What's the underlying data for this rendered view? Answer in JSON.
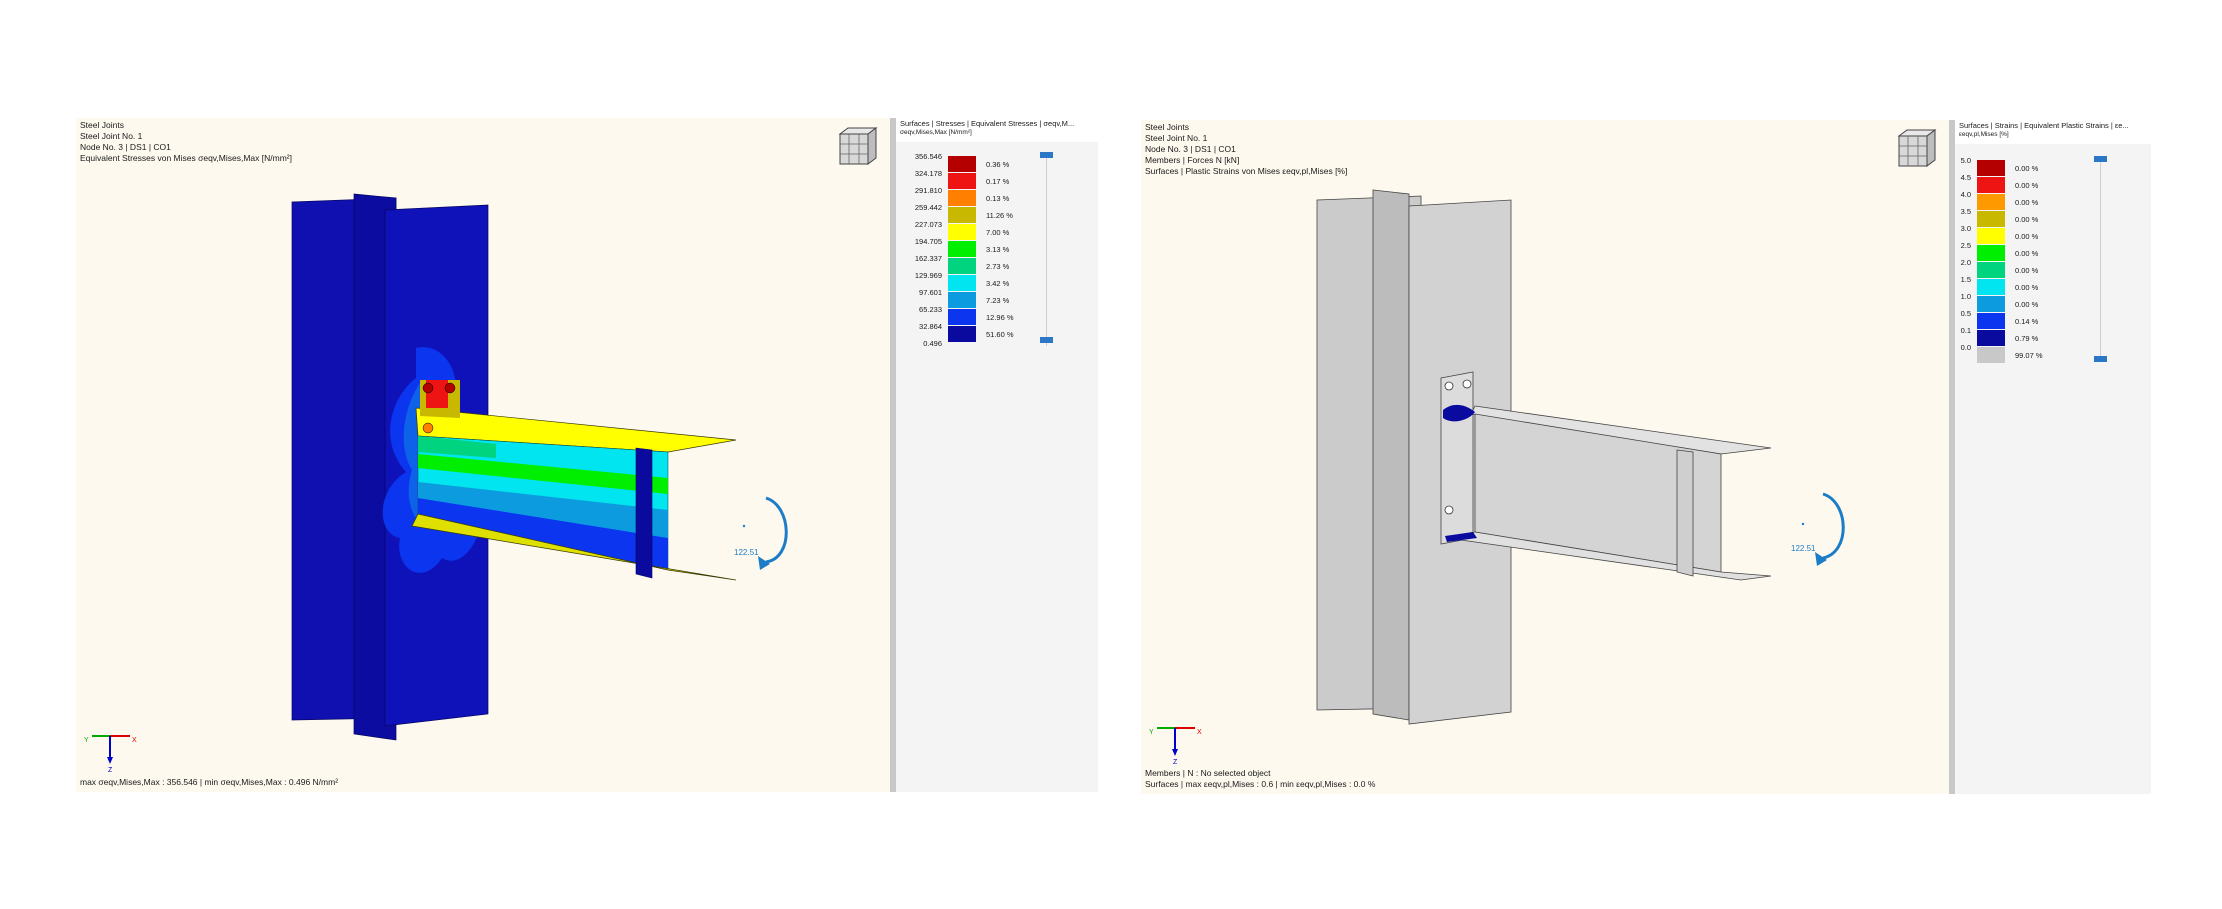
{
  "left_view": {
    "info_lines": [
      "Steel Joints",
      "Steel Joint No. 1",
      "Node No. 3 | DS1 | CO1",
      "Equivalent Stresses von Mises σeqv,Mises,Max [N/mm²]"
    ],
    "footer": "max σeqv,Mises,Max : 356.546 | min σeqv,Mises,Max : 0.496 N/mm²",
    "moment_label": "122.51"
  },
  "left_panel": {
    "title": "Surfaces | Stresses | Equivalent Stresses | σeqv,M...",
    "subtitle": "σeqv,Mises,Max [N/mm²]",
    "legend": [
      {
        "value": "356.546",
        "color": "#b40000",
        "pct": "0.36 %"
      },
      {
        "value": "324.178",
        "color": "#ee1414",
        "pct": "0.17 %"
      },
      {
        "value": "291.810",
        "color": "#ff7f00",
        "pct": "0.13 %"
      },
      {
        "value": "259.442",
        "color": "#c9b800",
        "pct": "11.26 %"
      },
      {
        "value": "227.073",
        "color": "#ffff00",
        "pct": "7.00 %"
      },
      {
        "value": "194.705",
        "color": "#00ee00",
        "pct": "3.13 %"
      },
      {
        "value": "162.337",
        "color": "#00d47f",
        "pct": "2.73 %"
      },
      {
        "value": "129.969",
        "color": "#00e5ef",
        "pct": "3.42 %"
      },
      {
        "value": "97.601",
        "color": "#0d9be0",
        "pct": "7.23 %"
      },
      {
        "value": "65.233",
        "color": "#0b35ee",
        "pct": "12.96 %"
      },
      {
        "value": "32.864",
        "color": "#0a0a9e",
        "pct": "51.60 %"
      }
    ],
    "legend_min": "0.496"
  },
  "right_view": {
    "info_lines": [
      "Steel Joints",
      "Steel Joint No. 1",
      "Node No. 3 | DS1 | CO1",
      "Members | Forces N [kN]",
      "Surfaces | Plastic Strains von Mises εeqv,pl,Mises [%]"
    ],
    "footer_lines": [
      "Members | N : No selected object",
      "Surfaces | max εeqv,pl,Mises : 0.6 | min εeqv,pl,Mises : 0.0 %"
    ],
    "moment_label": "122.51"
  },
  "right_panel": {
    "title": "Surfaces | Strains | Equivalent Plastic Strains | εe...",
    "subtitle": "εeqv,pl,Mises [%]",
    "legend": [
      {
        "value": "5.0",
        "color": "#b40000",
        "pct": "0.00 %"
      },
      {
        "value": "4.5",
        "color": "#ee1414",
        "pct": "0.00 %"
      },
      {
        "value": "4.0",
        "color": "#ff9900",
        "pct": "0.00 %"
      },
      {
        "value": "3.5",
        "color": "#c9b800",
        "pct": "0.00 %"
      },
      {
        "value": "3.0",
        "color": "#ffff00",
        "pct": "0.00 %"
      },
      {
        "value": "2.5",
        "color": "#00ee00",
        "pct": "0.00 %"
      },
      {
        "value": "2.0",
        "color": "#00d47f",
        "pct": "0.00 %"
      },
      {
        "value": "1.5",
        "color": "#00e5ef",
        "pct": "0.00 %"
      },
      {
        "value": "1.0",
        "color": "#0d9be0",
        "pct": "0.00 %"
      },
      {
        "value": "0.5",
        "color": "#0b35ee",
        "pct": "0.14 %"
      },
      {
        "value": "0.1",
        "color": "#0a0a9e",
        "pct": "0.79 %"
      },
      {
        "value": "0.0",
        "color": "#c8c8c8",
        "pct": "99.07 %"
      }
    ]
  },
  "axes": {
    "x": "X",
    "y": "Y",
    "z": "Z"
  }
}
